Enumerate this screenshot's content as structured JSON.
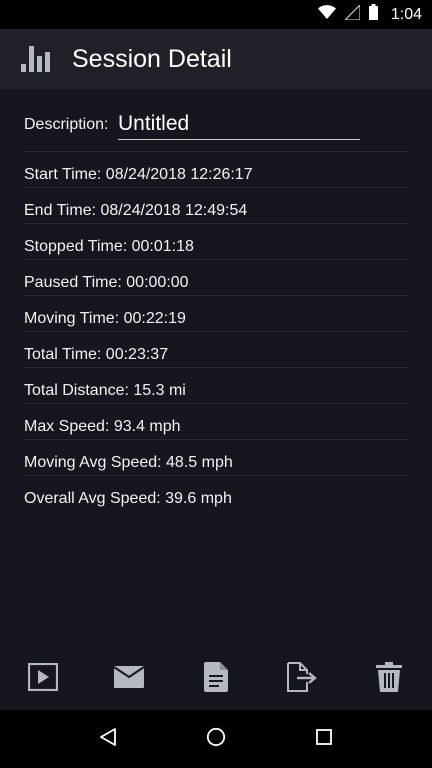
{
  "status_bar": {
    "time": "1:04",
    "icons": [
      "wifi-icon",
      "signal-icon",
      "battery-icon"
    ]
  },
  "header": {
    "title": "Session Detail",
    "icon": "bar-chart-icon"
  },
  "description": {
    "label": "Description:",
    "value": "Untitled"
  },
  "stats": [
    "Start Time: 08/24/2018 12:26:17",
    "End Time: 08/24/2018 12:49:54",
    "Stopped Time: 00:01:18",
    "Paused Time: 00:00:00",
    "Moving Time: 00:22:19",
    "Total Time: 00:23:37",
    "Total Distance: 15.3 mi",
    "Max Speed: 93.4 mph",
    "Moving Avg Speed: 48.5 mph",
    "Overall Avg Speed: 39.6 mph"
  ],
  "toolbar": {
    "icons": [
      "play-icon",
      "email-icon",
      "document-icon",
      "export-icon",
      "trash-icon"
    ]
  },
  "nav": {
    "icons": [
      "back-icon",
      "home-icon",
      "recents-icon"
    ]
  },
  "colors": {
    "background": "#15161e",
    "action_bar": "#202128",
    "icon_gray": "#b4b8c0",
    "divider": "#2a2b33"
  }
}
